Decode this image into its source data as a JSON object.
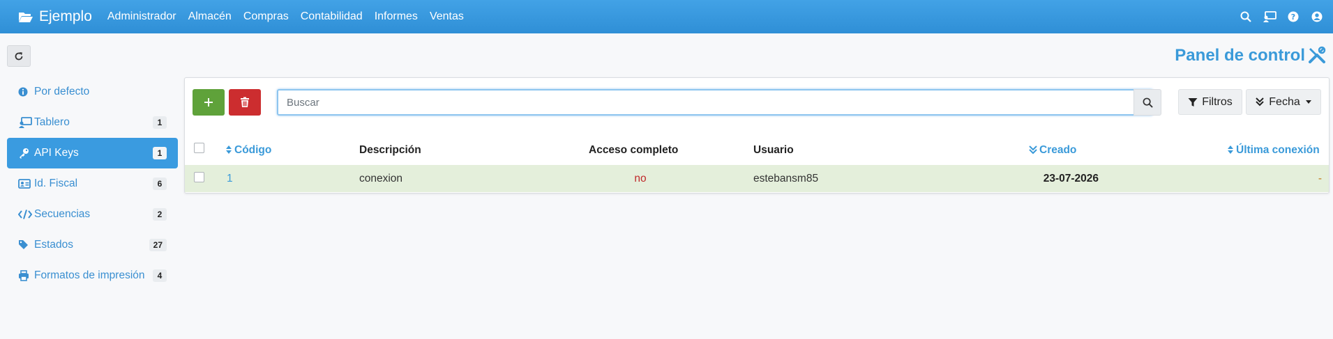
{
  "app": {
    "brand": "Ejemplo",
    "menu": [
      "Administrador",
      "Almacén",
      "Compras",
      "Contabilidad",
      "Informes",
      "Ventas"
    ]
  },
  "page": {
    "title": "Panel de control"
  },
  "sidebar": {
    "items": [
      {
        "label": "Por defecto",
        "icon": "info-icon",
        "count": null
      },
      {
        "label": "Tablero",
        "icon": "dashboard-icon",
        "count": "1"
      },
      {
        "label": "API Keys",
        "icon": "key-icon",
        "count": "1",
        "active": true
      },
      {
        "label": "Id. Fiscal",
        "icon": "id-card-icon",
        "count": "6"
      },
      {
        "label": "Secuencias",
        "icon": "code-icon",
        "count": "2"
      },
      {
        "label": "Estados",
        "icon": "tags-icon",
        "count": "27"
      },
      {
        "label": "Formatos de impresión",
        "icon": "print-icon",
        "count": "4"
      }
    ]
  },
  "toolbar": {
    "search_placeholder": "Buscar",
    "filters_label": "Filtros",
    "sort_label": "Fecha"
  },
  "table": {
    "headers": {
      "codigo": "Código",
      "descripcion": "Descripción",
      "acceso": "Acceso completo",
      "usuario": "Usuario",
      "creado": "Creado",
      "ultima": "Última conexión"
    },
    "rows": [
      {
        "codigo": "1",
        "descripcion": "conexion",
        "acceso": "no",
        "usuario": "estebansm85",
        "creado": "23-07-2026",
        "ultima": "-"
      }
    ]
  },
  "colors": {
    "navbar": "#3a9be0",
    "link": "#3a9ad9",
    "add_button": "#5fa23a",
    "delete_button": "#cc2d2f",
    "row_highlight": "#e4efdb",
    "no_value": "#c0292b"
  }
}
